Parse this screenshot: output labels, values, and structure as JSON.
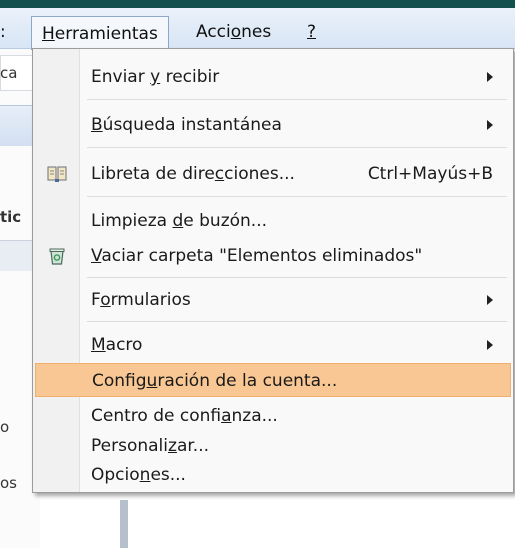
{
  "menubar": {
    "prev_fragment": ":",
    "herramientas": {
      "u": "H",
      "rest": "erramientas"
    },
    "acciones": {
      "pre": "Acci",
      "u": "o",
      "post": "nes"
    },
    "help": "?"
  },
  "background": {
    "search_fragment": "ca",
    "heading_fragment": "tic",
    "row1_fragment": "o",
    "row2_fragment": "os"
  },
  "menu": {
    "enviar_recibir": {
      "pre": "Enviar ",
      "u": "y",
      "post": " recibir"
    },
    "busqueda": {
      "pre": "",
      "u": "B",
      "post": "úsqueda instantánea"
    },
    "libreta": {
      "pre": "Libreta de dire",
      "u": "c",
      "post": "ciones...",
      "shortcut": "Ctrl+Mayús+B"
    },
    "limpieza": {
      "pre": "Limpieza ",
      "u": "d",
      "post": "e buzón..."
    },
    "vaciar": {
      "pre": "",
      "u": "V",
      "post": "aciar carpeta \"Elementos eliminados\""
    },
    "formularios": {
      "pre": "F",
      "u": "o",
      "post": "rmularios"
    },
    "macro": {
      "pre": "",
      "u": "M",
      "post": "acro"
    },
    "configuracion": {
      "pre": "Config",
      "u": "u",
      "post": "ración de la cuenta..."
    },
    "centro": {
      "pre": "Centro de confi",
      "u": "a",
      "post": "nza..."
    },
    "personalizar": {
      "pre": "Personali",
      "u": "z",
      "post": "ar..."
    },
    "opciones": {
      "pre": "Opcio",
      "u": "n",
      "post": "es..."
    }
  },
  "colors": {
    "highlight": "#f8c793",
    "highlight_border": "#eeb06e",
    "menubar_top": "#12504d"
  },
  "icons": {
    "libreta": "address-book-icon",
    "vaciar": "recycle-bin-icon"
  }
}
